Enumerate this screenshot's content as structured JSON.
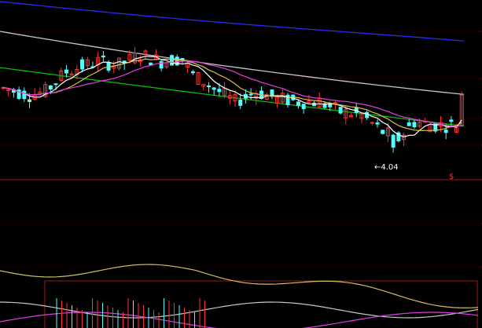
{
  "chart_data": {
    "type": "candlestick",
    "grid": true,
    "annotations": {
      "low_label": "←4.04",
      "low_value": 4.04,
      "marker_symbol": "$"
    },
    "colors": {
      "background": "#000000",
      "up_candle": "#ff3232",
      "down_candle": "#54fcfc",
      "ma_short": "#ffffff",
      "ma_mid1": "#e0c050",
      "ma_mid2": "#e040e0",
      "ma_long1": "#00c000",
      "ma_long2": "#c8c8c8",
      "ma_long3": "#2a2af0",
      "grid": "#6a0000",
      "frame": "#a01818",
      "lower_band": "#d0c060"
    },
    "y_range": [
      3.8,
      6.2
    ]
  }
}
